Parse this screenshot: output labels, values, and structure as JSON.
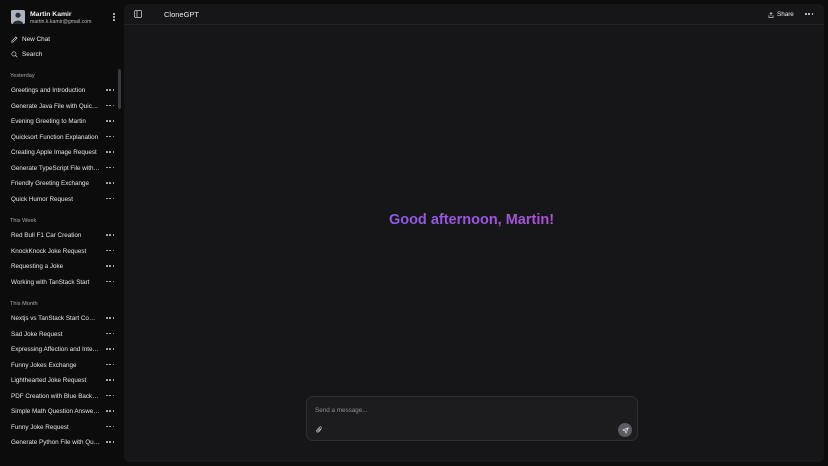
{
  "profile": {
    "name": "Martin Kamir",
    "email": "martin.k.kamir@gmail.com"
  },
  "nav": {
    "new_chat": "New Chat",
    "search": "Search"
  },
  "sections": [
    {
      "label": "Yesterday",
      "items": [
        "Greetings and Introduction",
        "Generate Java File with Quicksort",
        "Evening Greeting to Martin",
        "Quicksort Function Explanation",
        "Creating Apple Image Request",
        "Generate TypeScript File with Quicksort",
        "Friendly Greeting Exchange",
        "Quick Humor Request"
      ]
    },
    {
      "label": "This Week",
      "items": [
        "Red Bull F1 Car Creation",
        "KnockKnock Joke Request",
        "Requesting a Joke",
        "Working with TanStack Start"
      ]
    },
    {
      "label": "This Month",
      "items": [
        "Nextjs vs TanStack Start Comparison",
        "Sad Joke Request",
        "Expressing Affection and Interest",
        "Funny Jokes Exchange",
        "Lighthearted Joke Request",
        "PDF Creation with Blue Background",
        "Simple Math Question Answered",
        "Funny Joke Request",
        "Generate Python File with Quicksort"
      ]
    }
  ],
  "header": {
    "title": "CloneGPT",
    "share_label": "Share"
  },
  "greeting": "Good afternoon, Martin!",
  "composer": {
    "placeholder": "Send a message..."
  },
  "colors": {
    "background": "#0c0c0d",
    "panel": "#161618",
    "gradient_start": "#6a63ee",
    "gradient_end": "#e03f9f"
  },
  "icons": {
    "new_chat": "edit-icon",
    "search": "search-icon",
    "toggle": "sidebar-toggle-icon",
    "share": "share-icon",
    "attach": "paperclip-icon",
    "send": "send-icon"
  }
}
